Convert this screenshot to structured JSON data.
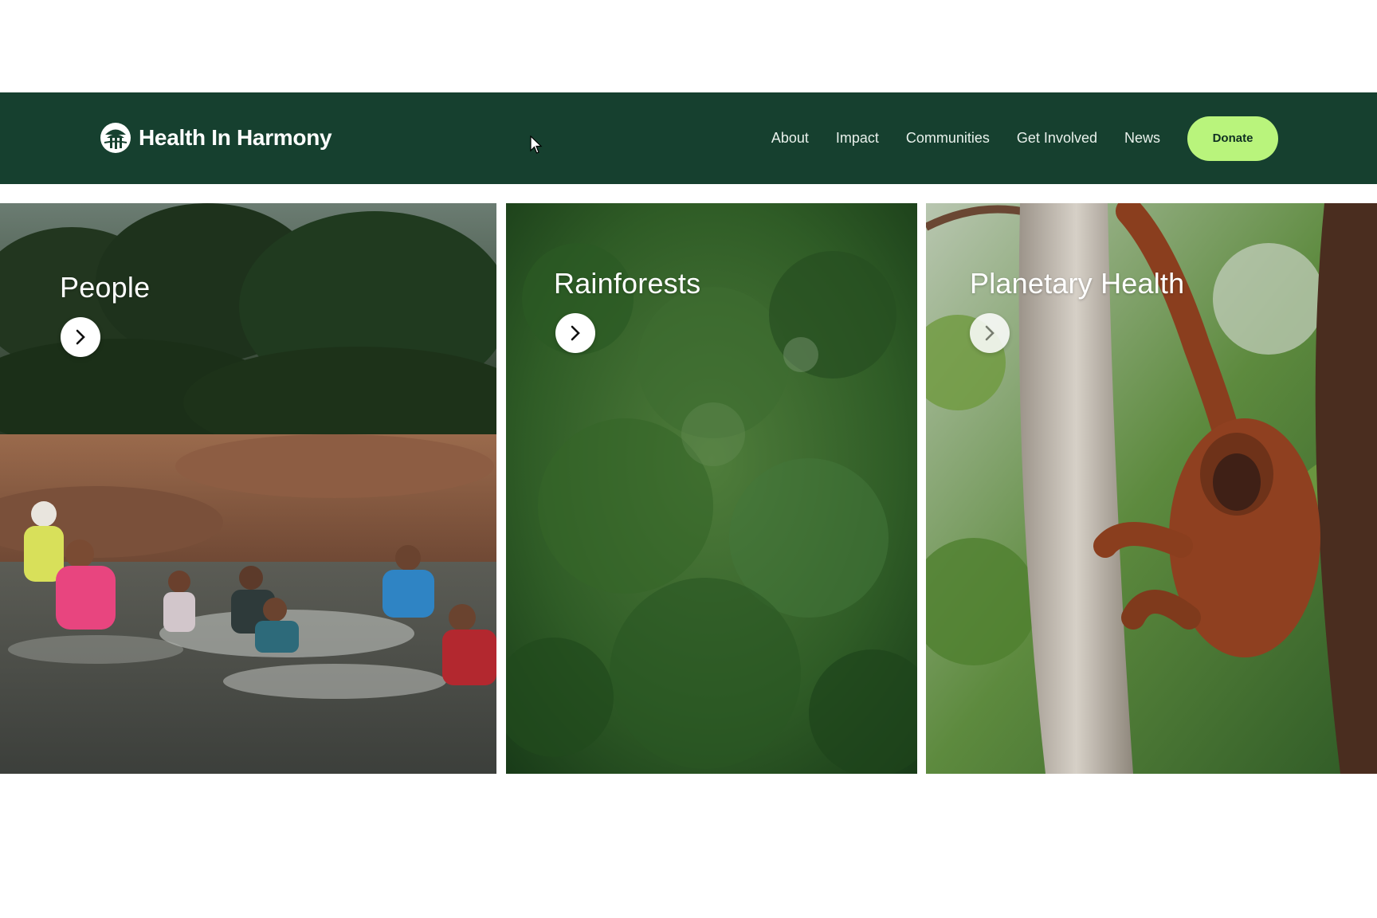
{
  "brand": {
    "name": "Health In Harmony",
    "logo_icon": "tree-icon"
  },
  "nav": {
    "items": [
      {
        "label": "About"
      },
      {
        "label": "Impact"
      },
      {
        "label": "Communities"
      },
      {
        "label": "Get Involved"
      },
      {
        "label": "News"
      }
    ],
    "donate_label": "Donate"
  },
  "cards": [
    {
      "title": "People",
      "icon": "chevron-right-icon"
    },
    {
      "title": "Rainforests",
      "icon": "chevron-right-icon"
    },
    {
      "title": "Planetary Health",
      "icon": "chevron-right-icon"
    }
  ],
  "colors": {
    "header_bg": "#16402f",
    "donate_bg": "#b9f47c",
    "text_on_dark": "#ffffff"
  }
}
